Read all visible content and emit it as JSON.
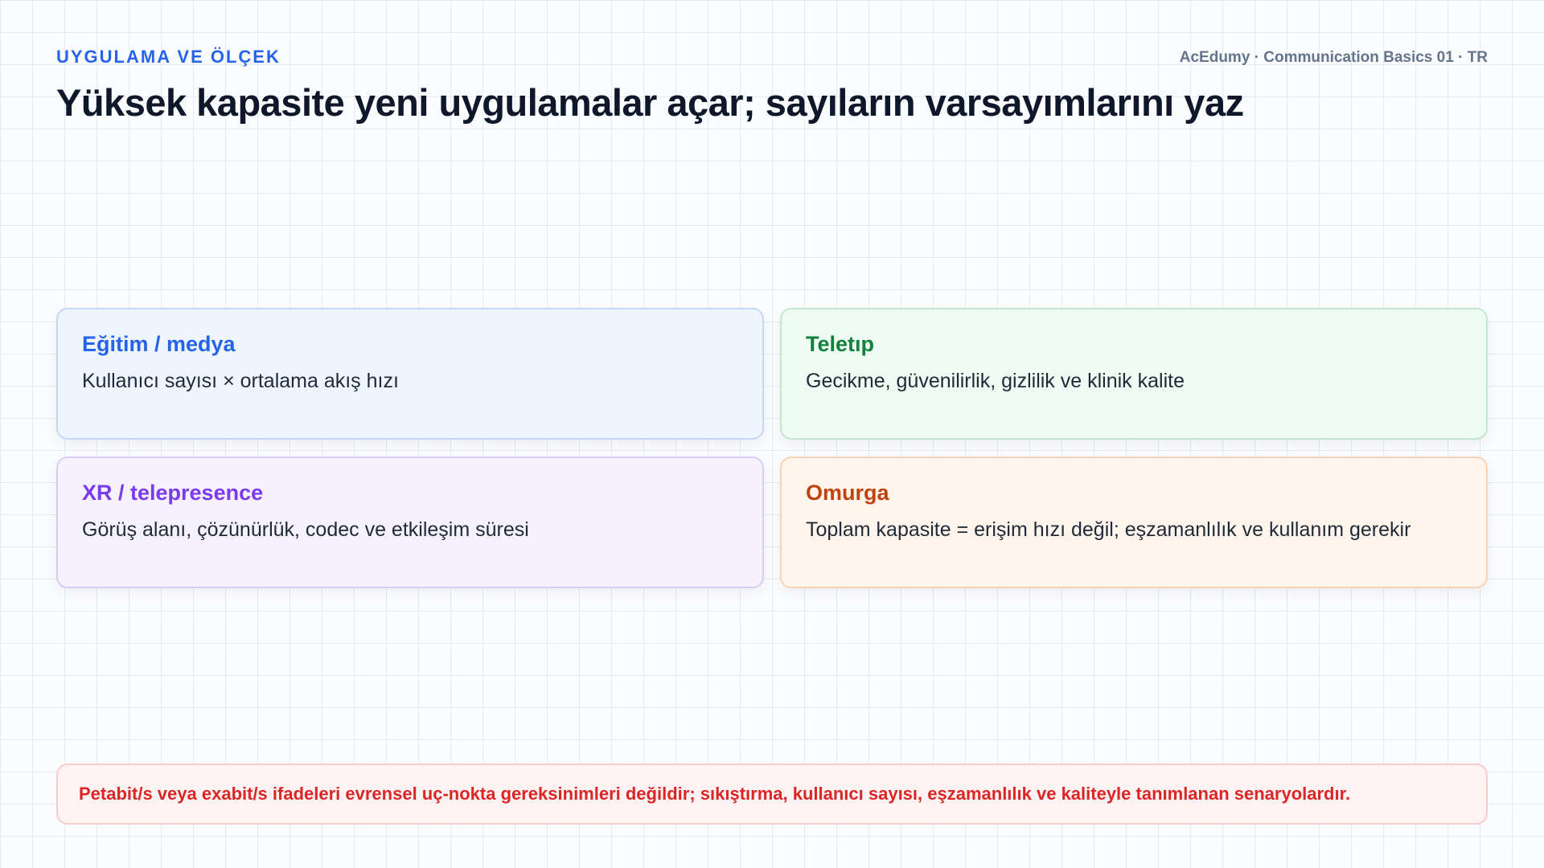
{
  "header": {
    "eyebrow": "UYGULAMA VE ÖLÇEK",
    "meta": "AcEdumy · Communication Basics 01 · TR",
    "title": "Yüksek kapasite yeni uygulamalar açar; sayıların varsayımlarını yaz"
  },
  "cards": [
    {
      "title": "Eğitim / medya",
      "body": "Kullanıcı sayısı × ortalama akış hızı",
      "accent": "#2563eb"
    },
    {
      "title": "Teletıp",
      "body": "Gecikme, güvenilirlik, gizlilik ve klinik kalite",
      "accent": "#15803d"
    },
    {
      "title": "XR / telepresence",
      "body": "Görüş alanı, çözünürlük, codec ve etkileşim süresi",
      "accent": "#7c3aed"
    },
    {
      "title": "Omurga",
      "body": "Toplam kapasite = erişim hızı değil; eşzamanlılık ve kullanım gerekir",
      "accent": "#c2410c"
    }
  ],
  "note": {
    "text": "Petabit/s veya exabit/s ifadeleri evrensel uç-nokta gereksinimleri değildir; sıkıştırma, kullanıcı sayısı, eşzamanlılık ve kaliteyle tanımlanan senaryolardır.",
    "color": "#dc2626"
  }
}
